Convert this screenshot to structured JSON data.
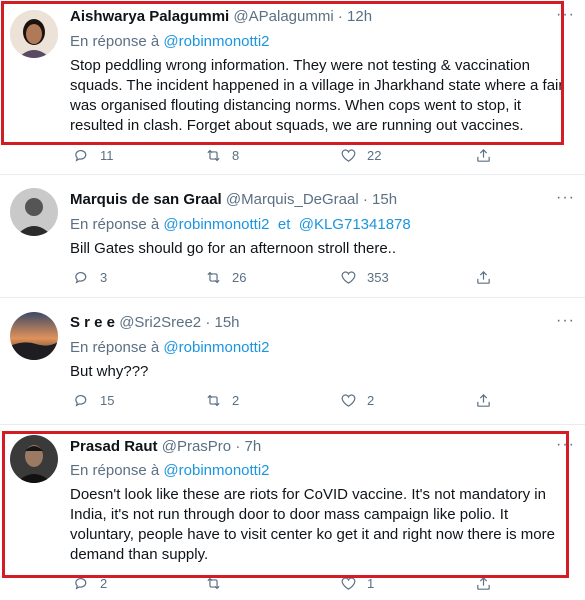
{
  "reply_prefix": "En réponse à",
  "tweets": [
    {
      "name": "Aishwarya Palagummi",
      "handle": "@APalagummi",
      "time": "12h",
      "mentions": [
        "@robinmonotti2"
      ],
      "text": "Stop peddling wrong information. They were not testing & vaccination squads. The incident happened in a village in Jharkhand state where a fair was organised flouting distancing norms. When cops went to stop, it resulted in clash. Forget about squads, we are running out vaccines.",
      "replies": "11",
      "retweets": "8",
      "likes": "22"
    },
    {
      "name": "Marquis de san Graal",
      "handle": "@Marquis_DeGraal",
      "time": "15h",
      "mentions": [
        "@robinmonotti2",
        "@KLG71341878"
      ],
      "joiner": "et",
      "text": "Bill Gates should go for an afternoon stroll there..",
      "replies": "3",
      "retweets": "26",
      "likes": "353"
    },
    {
      "name": "S r e e",
      "handle": "@Sri2Sree2",
      "time": "15h",
      "mentions": [
        "@robinmonotti2"
      ],
      "text": "But why???",
      "replies": "15",
      "retweets": "2",
      "likes": "2"
    },
    {
      "name": "Prasad Raut",
      "handle": "@PrasPro",
      "time": "7h",
      "mentions": [
        "@robinmonotti2"
      ],
      "text": "Doesn't look like these are riots for CoVID vaccine. It's not mandatory in India, it's not run through door to door mass campaign like polio. It voluntary, people have to visit center ko get it and right now there is more demand than supply.",
      "replies": "2",
      "retweets": "",
      "likes": "1"
    }
  ]
}
